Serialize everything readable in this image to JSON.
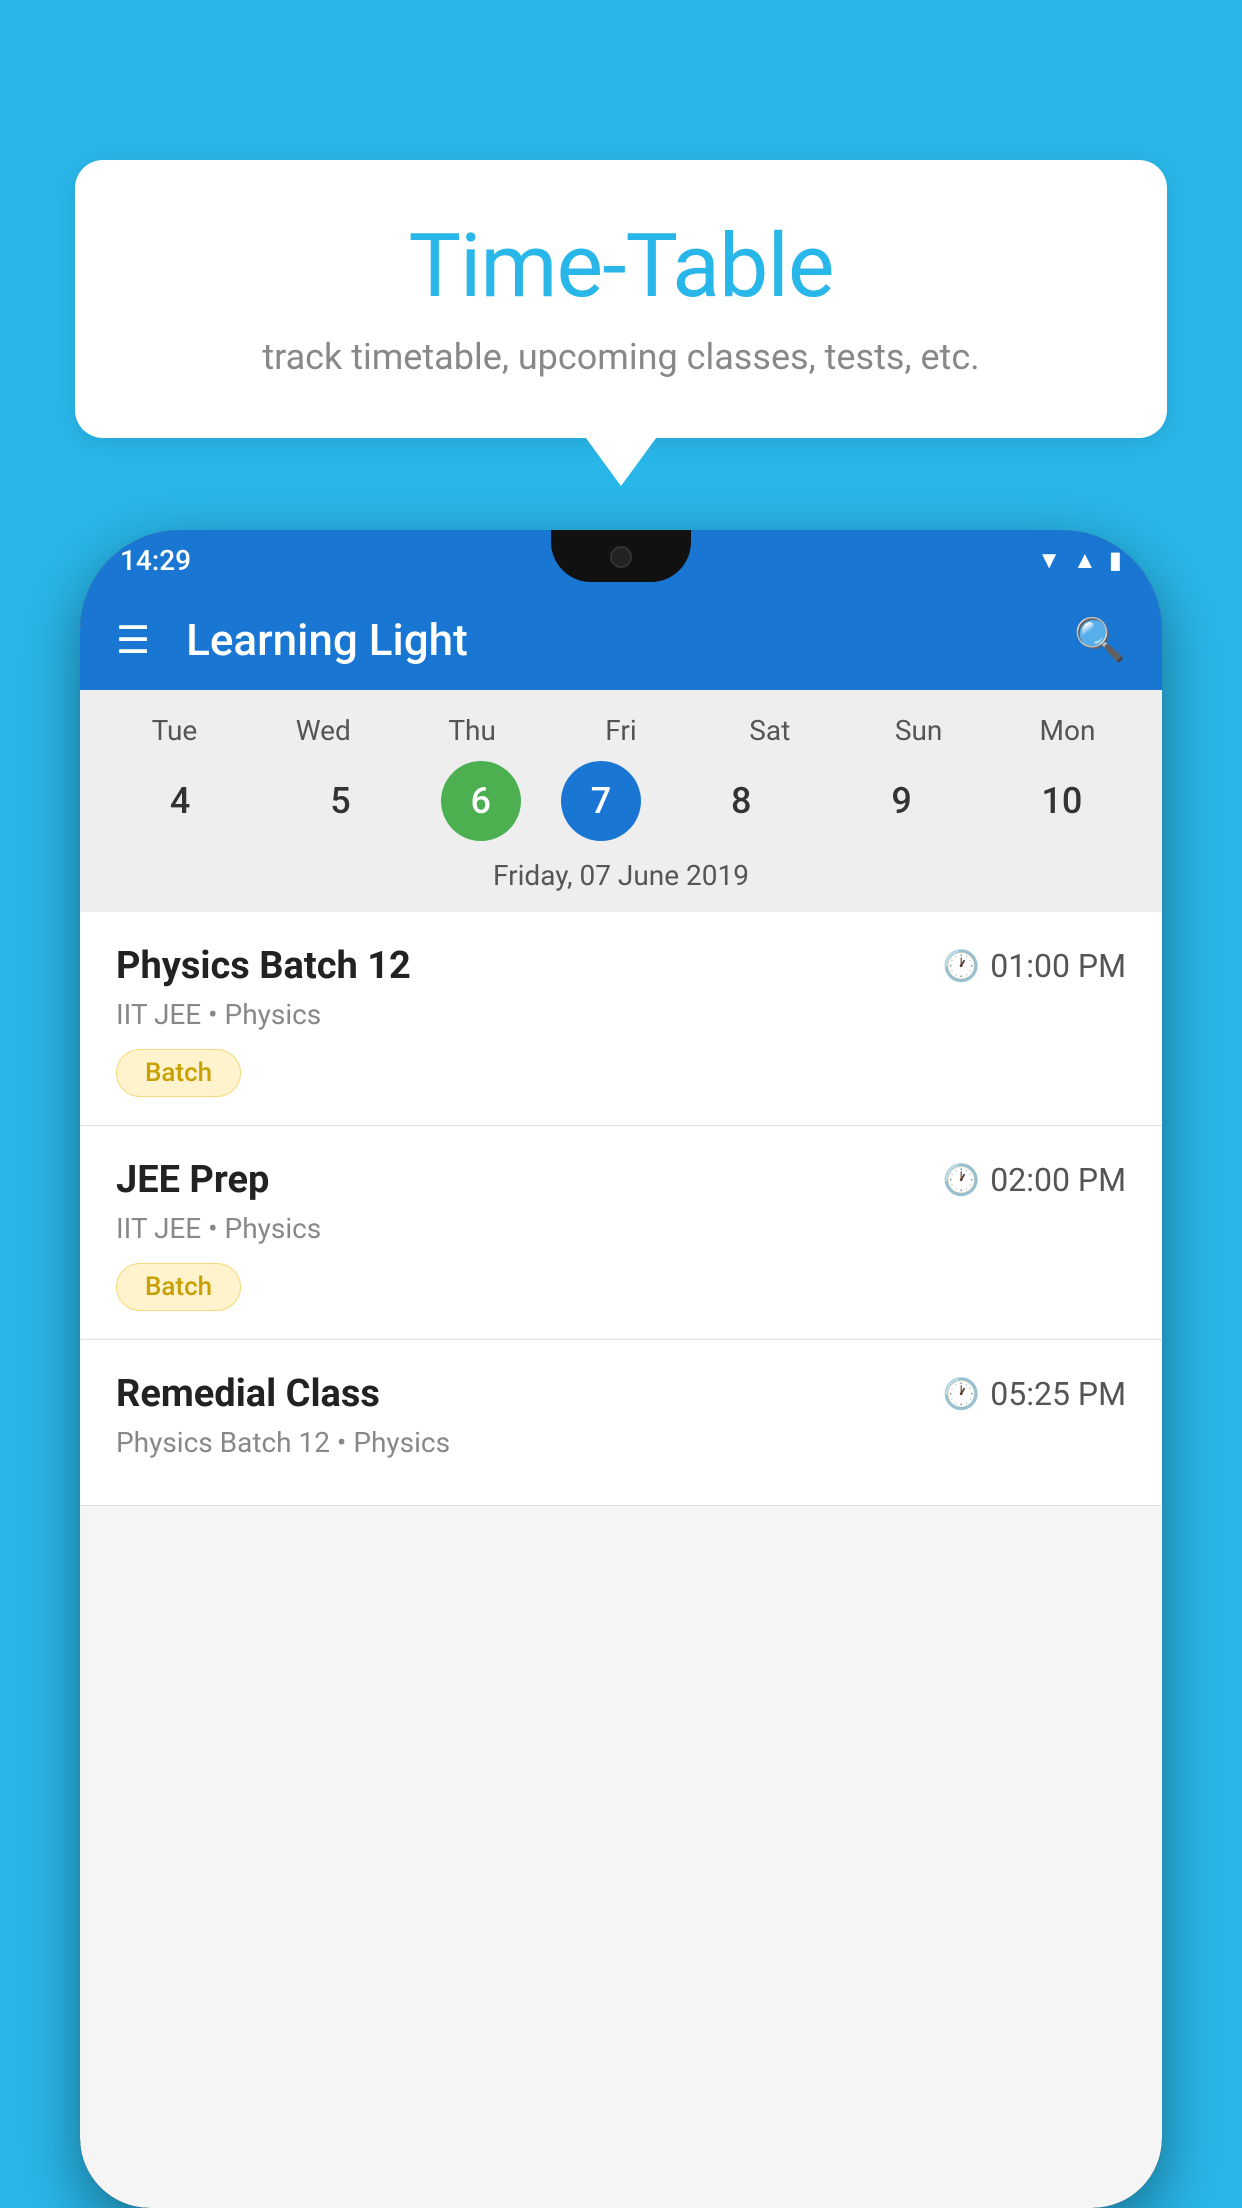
{
  "background_color": "#29b6e8",
  "speech_bubble": {
    "title": "Time-Table",
    "subtitle": "track timetable, upcoming classes, tests, etc."
  },
  "phone": {
    "status_bar": {
      "time": "14:29"
    },
    "app_bar": {
      "title": "Learning Light"
    },
    "calendar": {
      "days": [
        {
          "name": "Tue",
          "number": "4",
          "state": "normal"
        },
        {
          "name": "Wed",
          "number": "5",
          "state": "normal"
        },
        {
          "name": "Thu",
          "number": "6",
          "state": "today"
        },
        {
          "name": "Fri",
          "number": "7",
          "state": "selected"
        },
        {
          "name": "Sat",
          "number": "8",
          "state": "normal"
        },
        {
          "name": "Sun",
          "number": "9",
          "state": "normal"
        },
        {
          "name": "Mon",
          "number": "10",
          "state": "normal"
        }
      ],
      "selected_date_label": "Friday, 07 June 2019"
    },
    "schedule_items": [
      {
        "title": "Physics Batch 12",
        "time": "01:00 PM",
        "subtitle": "IIT JEE • Physics",
        "tag": "Batch"
      },
      {
        "title": "JEE Prep",
        "time": "02:00 PM",
        "subtitle": "IIT JEE • Physics",
        "tag": "Batch"
      },
      {
        "title": "Remedial Class",
        "time": "05:25 PM",
        "subtitle": "Physics Batch 12 • Physics",
        "tag": ""
      }
    ]
  }
}
